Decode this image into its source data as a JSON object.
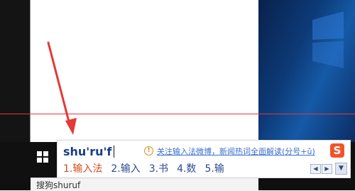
{
  "colors": {
    "wallpaper_dark": "#09214c",
    "wallpaper_light": "#155aa7",
    "taskbar": "#101010",
    "red_guide_line": "#e53935",
    "pinyin_text": "#1a3d8a",
    "candidate_text": "#2c4a8f",
    "candidate_selected": "#d34b1f",
    "link_text": "#3a6fcf",
    "sogou_brand": "#f0542b",
    "arrow": "#e53935"
  },
  "ime": {
    "pinyin_input": "shu'ru'f",
    "info_icon": "info-circle-icon",
    "news_link": "关注输入法微博，新闻热词全面解读(分号+ǔ)",
    "logo_icon": "sogou-s-icon",
    "logo_text": "S",
    "candidates": [
      {
        "label": "1.输入法"
      },
      {
        "label": "2.输入"
      },
      {
        "label": "3.书"
      },
      {
        "label": "4.数"
      },
      {
        "label": "5.输"
      }
    ],
    "prev_page_icon": "triangle-left-icon",
    "prev_page_glyph": "◀",
    "next_page_icon": "triangle-right-icon",
    "next_page_glyph": "▶",
    "expand_icon": "triangle-down-icon",
    "expand_glyph": "▼"
  },
  "taskbar": {
    "start_icon": "windows-start-icon",
    "search_text": "搜狗shuruf"
  }
}
